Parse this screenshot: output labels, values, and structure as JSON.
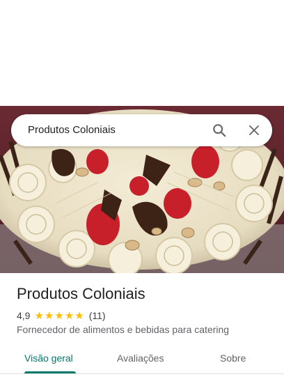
{
  "search": {
    "query": "Produtos Coloniais",
    "search_icon": "search-icon",
    "close_icon": "close-icon"
  },
  "hero": {
    "image": "cake-photo"
  },
  "place": {
    "name": "Produtos Coloniais",
    "rating": "4,9",
    "stars": 5,
    "review_count": "(11)",
    "category": "Fornecedor de alimentos e bebidas para catering"
  },
  "tabs": [
    {
      "label": "Visão geral",
      "active": true
    },
    {
      "label": "Avaliações",
      "active": false
    },
    {
      "label": "Sobre",
      "active": false
    }
  ],
  "colors": {
    "accent": "#00796b",
    "star": "#fbbc04",
    "text_primary": "#202124",
    "text_secondary": "#5f6368"
  }
}
